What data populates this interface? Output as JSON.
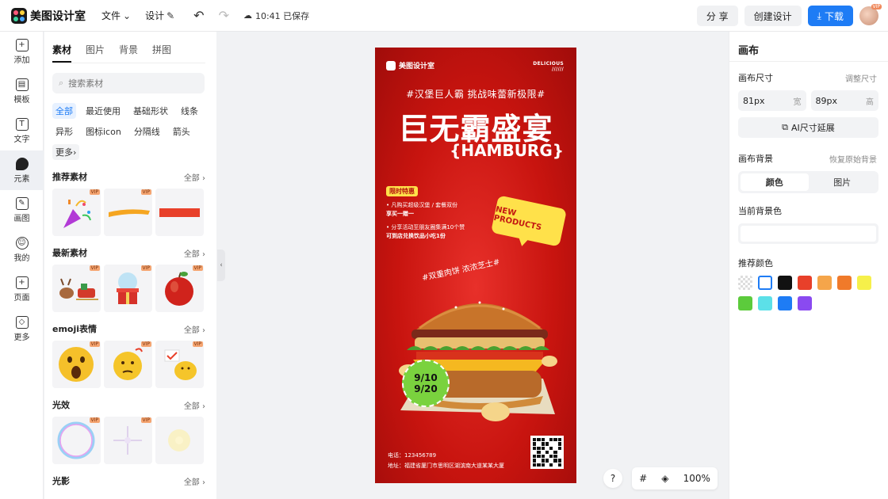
{
  "app": {
    "name": "美图设计室",
    "menu": [
      "文件",
      "设计"
    ],
    "save_status": "10:41 已保存",
    "share_label": "分 享",
    "create_label": "创建设计",
    "download_label": "下载",
    "avatar_badge": "VIP"
  },
  "rail": [
    {
      "label": "添加",
      "icon": "plus-square-icon"
    },
    {
      "label": "模板",
      "icon": "template-icon"
    },
    {
      "label": "文字",
      "icon": "text-icon"
    },
    {
      "label": "元素",
      "icon": "element-icon"
    },
    {
      "label": "画图",
      "icon": "draw-icon"
    },
    {
      "label": "我的",
      "icon": "profile-icon"
    },
    {
      "label": "页面",
      "icon": "page-add-icon"
    },
    {
      "label": "更多",
      "icon": "cube-icon"
    }
  ],
  "assets": {
    "tabs": [
      "素材",
      "图片",
      "背景",
      "拼图"
    ],
    "search_placeholder": "搜索素材",
    "chips": [
      "全部",
      "最近使用",
      "基础形状",
      "线条",
      "异形",
      "图标icon",
      "分隔线",
      "箭头",
      "更多"
    ],
    "all_label": "全部",
    "vip": "VIP",
    "sections": [
      "推荐素材",
      "最新素材",
      "emoji表情",
      "光效",
      "光影"
    ]
  },
  "poster": {
    "brand": "美图设计室",
    "delicious": "DELICIOUS",
    "delicious_sub": "//////",
    "hashtag": "#汉堡巨人霸 挑战味蕾新极限#",
    "title": "巨无霸盛宴",
    "subtitle": "{HAMBURG}",
    "badge": "限时特惠",
    "offer1_a": "• 凡购买超级汉堡 / 套餐双份",
    "offer1_b": "享买一赠一",
    "offer2_a": "• 分享活动至朋友圈集满10个赞",
    "offer2_b": "可到店兑换饮品小吃1份",
    "bubble": "NEW PRODUCTS",
    "hashtag2": "#双重肉饼 浓浓芝士#",
    "date_start": "9/10",
    "date_end": "9/20",
    "phone": "电话：123456789",
    "address": "地址：福建省厦门市思明区湖滨南大道某某大厦"
  },
  "canvas_controls": {
    "help": "?",
    "zoom": "100%"
  },
  "right_panel": {
    "title": "画布",
    "size_label": "画布尺寸",
    "adjust_size": "调整尺寸",
    "width_value": "81px",
    "width_unit": "宽",
    "height_value": "89px",
    "height_unit": "高",
    "ai_extend": "AI尺寸延展",
    "bg_label": "画布背景",
    "restore_bg": "恢复原始背景",
    "seg_color": "颜色",
    "seg_image": "图片",
    "current_bg": "当前背景色",
    "recommended": "推荐颜色",
    "colors": [
      "transparent",
      "#ffffff",
      "#111111",
      "#e8402a",
      "#f5a54a",
      "#f07a2a",
      "#f6f04a",
      "#5ccb3c",
      "#5ce0e8",
      "#1e7cf5",
      "#8a4af0"
    ]
  },
  "colors": {
    "accent": "#1e7cf5",
    "poster_red": "#c8140f",
    "poster_yellow": "#ffe14a",
    "date_green": "#7ad23e"
  }
}
